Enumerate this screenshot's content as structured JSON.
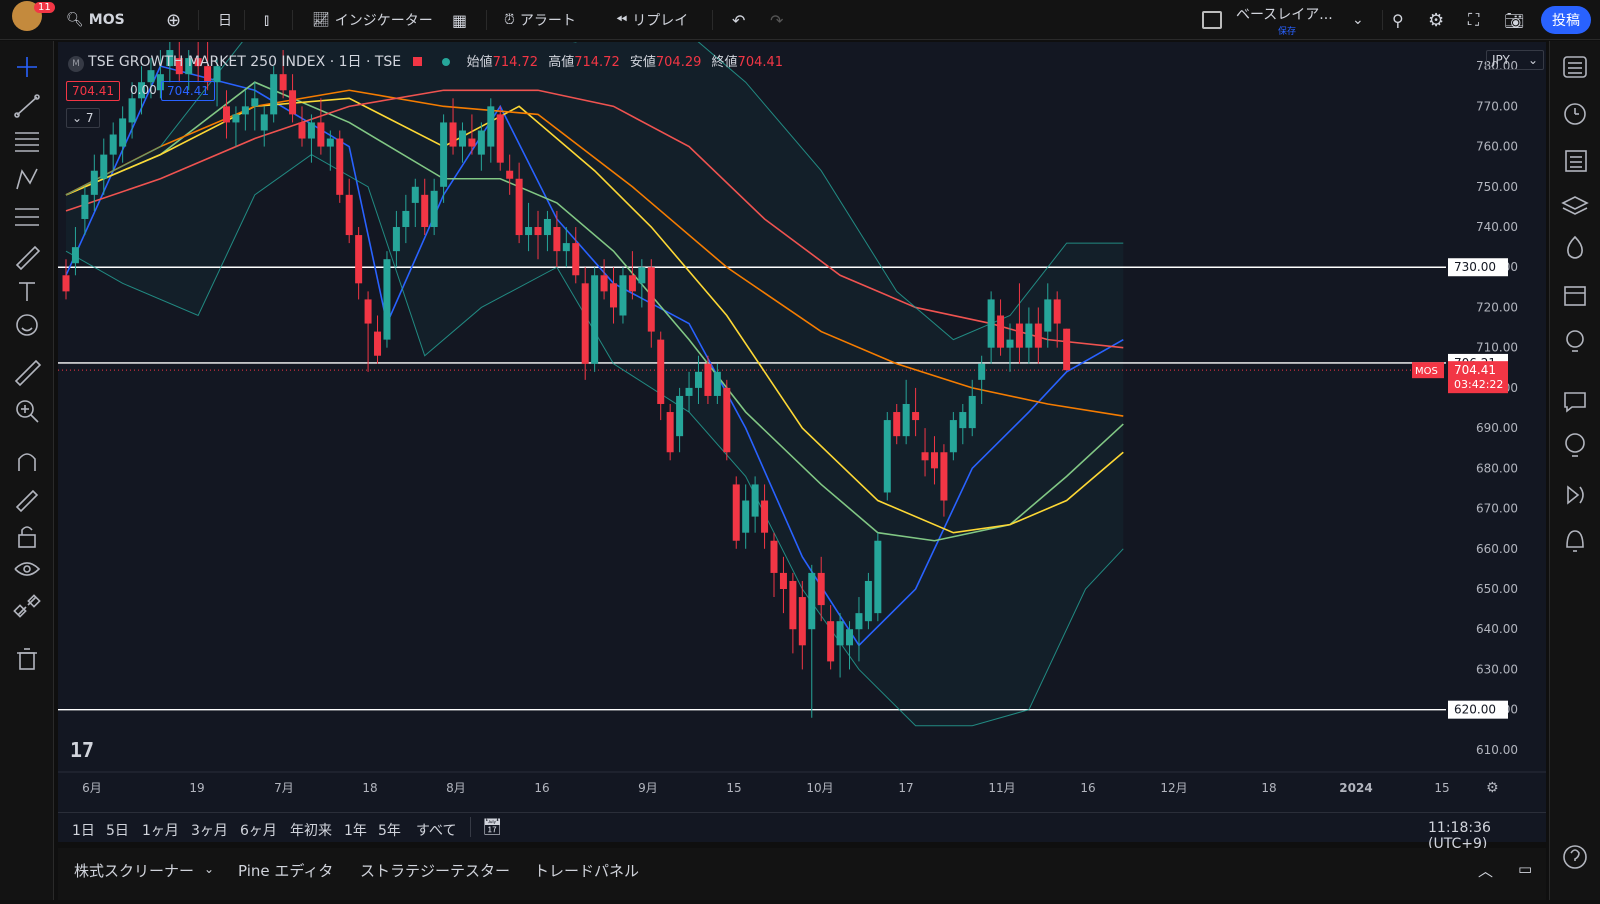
{
  "topbar": {
    "notif_count": "11",
    "symbol": "MOS",
    "interval": "日",
    "indicators": "インジケーター",
    "alert": "アラート",
    "replay": "リプレイ",
    "layout": "ベースレイア...",
    "layout_sub": "保存",
    "publish": "投稿"
  },
  "legend": {
    "title": "TSE GROWTH MARKET 250 INDEX · 1日 · TSE",
    "open_label": "始値",
    "open": "714.72",
    "high_label": "高値",
    "high": "714.72",
    "low_label": "安値",
    "low": "704.29",
    "close_label": "終値",
    "close": "704.41",
    "bid": "704.41",
    "spread": "0.00",
    "ask": "704.41",
    "indicators_count": "7"
  },
  "chart_data": {
    "type": "candlestick",
    "ylim": [
      605,
      786
    ],
    "y_ticks": [
      610,
      620,
      630,
      640,
      650,
      660,
      670,
      680,
      690,
      700,
      710,
      720,
      730,
      740,
      750,
      760,
      770,
      780
    ],
    "x_labels": [
      "6月",
      "19",
      "7月",
      "18",
      "8月",
      "16",
      "9月",
      "15",
      "10月",
      "17",
      "11月",
      "16",
      "12月",
      "18",
      "2024",
      "15"
    ],
    "currency": "JPY",
    "hlines": [
      730,
      706.21,
      620
    ],
    "hline_labels": [
      "730.00",
      "706.21",
      "620.00"
    ],
    "last_price": "704.41",
    "countdown": "03:42:22",
    "last_symbol": "MOS",
    "candles": [
      {
        "o": 728,
        "h": 732,
        "l": 722,
        "c": 724
      },
      {
        "o": 731,
        "h": 740,
        "l": 728,
        "c": 735
      },
      {
        "o": 742,
        "h": 750,
        "l": 738,
        "c": 748
      },
      {
        "o": 748,
        "h": 758,
        "l": 744,
        "c": 754
      },
      {
        "o": 752,
        "h": 762,
        "l": 748,
        "c": 758
      },
      {
        "o": 758,
        "h": 766,
        "l": 754,
        "c": 763
      },
      {
        "o": 760,
        "h": 770,
        "l": 756,
        "c": 767
      },
      {
        "o": 766,
        "h": 776,
        "l": 762,
        "c": 772
      },
      {
        "o": 772,
        "h": 780,
        "l": 768,
        "c": 776
      },
      {
        "o": 776,
        "h": 782,
        "l": 772,
        "c": 779
      },
      {
        "o": 774,
        "h": 784,
        "l": 772,
        "c": 778
      },
      {
        "o": 780,
        "h": 786,
        "l": 776,
        "c": 784
      },
      {
        "o": 782,
        "h": 786,
        "l": 776,
        "c": 778
      },
      {
        "o": 778,
        "h": 784,
        "l": 774,
        "c": 782
      },
      {
        "o": 782,
        "h": 786,
        "l": 776,
        "c": 780
      },
      {
        "o": 780,
        "h": 786,
        "l": 774,
        "c": 776
      },
      {
        "o": 776,
        "h": 782,
        "l": 770,
        "c": 780
      },
      {
        "o": 770,
        "h": 774,
        "l": 762,
        "c": 766
      },
      {
        "o": 766,
        "h": 770,
        "l": 760,
        "c": 768
      },
      {
        "o": 768,
        "h": 774,
        "l": 764,
        "c": 770
      },
      {
        "o": 770,
        "h": 776,
        "l": 764,
        "c": 772
      },
      {
        "o": 764,
        "h": 770,
        "l": 760,
        "c": 768
      },
      {
        "o": 768,
        "h": 780,
        "l": 766,
        "c": 778
      },
      {
        "o": 778,
        "h": 784,
        "l": 772,
        "c": 774
      },
      {
        "o": 774,
        "h": 778,
        "l": 766,
        "c": 768
      },
      {
        "o": 766,
        "h": 770,
        "l": 760,
        "c": 762
      },
      {
        "o": 762,
        "h": 768,
        "l": 756,
        "c": 766
      },
      {
        "o": 766,
        "h": 772,
        "l": 758,
        "c": 760
      },
      {
        "o": 760,
        "h": 764,
        "l": 754,
        "c": 762
      },
      {
        "o": 762,
        "h": 764,
        "l": 746,
        "c": 748
      },
      {
        "o": 748,
        "h": 752,
        "l": 736,
        "c": 738
      },
      {
        "o": 738,
        "h": 740,
        "l": 722,
        "c": 726
      },
      {
        "o": 722,
        "h": 724,
        "l": 704,
        "c": 716
      },
      {
        "o": 714,
        "h": 718,
        "l": 706,
        "c": 708
      },
      {
        "o": 712,
        "h": 734,
        "l": 710,
        "c": 732
      },
      {
        "o": 734,
        "h": 744,
        "l": 730,
        "c": 740
      },
      {
        "o": 740,
        "h": 748,
        "l": 736,
        "c": 744
      },
      {
        "o": 746,
        "h": 752,
        "l": 740,
        "c": 750
      },
      {
        "o": 748,
        "h": 752,
        "l": 738,
        "c": 740
      },
      {
        "o": 740,
        "h": 752,
        "l": 738,
        "c": 749
      },
      {
        "o": 750,
        "h": 768,
        "l": 746,
        "c": 766
      },
      {
        "o": 766,
        "h": 772,
        "l": 758,
        "c": 760
      },
      {
        "o": 760,
        "h": 766,
        "l": 756,
        "c": 764
      },
      {
        "o": 762,
        "h": 768,
        "l": 758,
        "c": 760
      },
      {
        "o": 758,
        "h": 766,
        "l": 754,
        "c": 764
      },
      {
        "o": 760,
        "h": 772,
        "l": 756,
        "c": 770
      },
      {
        "o": 768,
        "h": 770,
        "l": 754,
        "c": 756
      },
      {
        "o": 754,
        "h": 758,
        "l": 748,
        "c": 752
      },
      {
        "o": 752,
        "h": 756,
        "l": 736,
        "c": 738
      },
      {
        "o": 738,
        "h": 746,
        "l": 734,
        "c": 740
      },
      {
        "o": 740,
        "h": 744,
        "l": 732,
        "c": 738
      },
      {
        "o": 738,
        "h": 744,
        "l": 734,
        "c": 742
      },
      {
        "o": 740,
        "h": 744,
        "l": 730,
        "c": 734
      },
      {
        "o": 734,
        "h": 740,
        "l": 730,
        "c": 736
      },
      {
        "o": 736,
        "h": 740,
        "l": 726,
        "c": 728
      },
      {
        "o": 726,
        "h": 730,
        "l": 702,
        "c": 706
      },
      {
        "o": 706,
        "h": 730,
        "l": 704,
        "c": 728
      },
      {
        "o": 728,
        "h": 732,
        "l": 722,
        "c": 724
      },
      {
        "o": 726,
        "h": 730,
        "l": 716,
        "c": 720
      },
      {
        "o": 718,
        "h": 730,
        "l": 716,
        "c": 728
      },
      {
        "o": 728,
        "h": 734,
        "l": 722,
        "c": 724
      },
      {
        "o": 726,
        "h": 732,
        "l": 720,
        "c": 730
      },
      {
        "o": 730,
        "h": 732,
        "l": 710,
        "c": 714
      },
      {
        "o": 712,
        "h": 714,
        "l": 692,
        "c": 696
      },
      {
        "o": 694,
        "h": 696,
        "l": 682,
        "c": 684
      },
      {
        "o": 688,
        "h": 700,
        "l": 684,
        "c": 698
      },
      {
        "o": 698,
        "h": 704,
        "l": 694,
        "c": 700
      },
      {
        "o": 700,
        "h": 708,
        "l": 696,
        "c": 704
      },
      {
        "o": 706,
        "h": 708,
        "l": 696,
        "c": 698
      },
      {
        "o": 698,
        "h": 706,
        "l": 696,
        "c": 704
      },
      {
        "o": 700,
        "h": 702,
        "l": 682,
        "c": 684
      },
      {
        "o": 676,
        "h": 678,
        "l": 660,
        "c": 662
      },
      {
        "o": 664,
        "h": 676,
        "l": 660,
        "c": 672
      },
      {
        "o": 668,
        "h": 678,
        "l": 664,
        "c": 676
      },
      {
        "o": 672,
        "h": 676,
        "l": 660,
        "c": 664
      },
      {
        "o": 662,
        "h": 664,
        "l": 648,
        "c": 654
      },
      {
        "o": 654,
        "h": 658,
        "l": 644,
        "c": 650
      },
      {
        "o": 652,
        "h": 654,
        "l": 634,
        "c": 640
      },
      {
        "o": 648,
        "h": 652,
        "l": 630,
        "c": 636
      },
      {
        "o": 640,
        "h": 656,
        "l": 618,
        "c": 654
      },
      {
        "o": 654,
        "h": 658,
        "l": 642,
        "c": 646
      },
      {
        "o": 642,
        "h": 646,
        "l": 630,
        "c": 632
      },
      {
        "o": 636,
        "h": 644,
        "l": 628,
        "c": 642
      },
      {
        "o": 636,
        "h": 642,
        "l": 630,
        "c": 640
      },
      {
        "o": 640,
        "h": 648,
        "l": 632,
        "c": 644
      },
      {
        "o": 642,
        "h": 654,
        "l": 640,
        "c": 652
      },
      {
        "o": 644,
        "h": 664,
        "l": 642,
        "c": 662
      },
      {
        "o": 674,
        "h": 694,
        "l": 672,
        "c": 692
      },
      {
        "o": 694,
        "h": 696,
        "l": 686,
        "c": 688
      },
      {
        "o": 688,
        "h": 702,
        "l": 686,
        "c": 696
      },
      {
        "o": 694,
        "h": 700,
        "l": 688,
        "c": 692
      },
      {
        "o": 684,
        "h": 690,
        "l": 678,
        "c": 682
      },
      {
        "o": 684,
        "h": 688,
        "l": 676,
        "c": 680
      },
      {
        "o": 684,
        "h": 686,
        "l": 668,
        "c": 672
      },
      {
        "o": 684,
        "h": 694,
        "l": 682,
        "c": 692
      },
      {
        "o": 690,
        "h": 696,
        "l": 686,
        "c": 694
      },
      {
        "o": 690,
        "h": 702,
        "l": 688,
        "c": 698
      },
      {
        "o": 702,
        "h": 708,
        "l": 696,
        "c": 706
      },
      {
        "o": 710,
        "h": 724,
        "l": 706,
        "c": 722
      },
      {
        "o": 718,
        "h": 722,
        "l": 708,
        "c": 710
      },
      {
        "o": 710,
        "h": 716,
        "l": 704,
        "c": 712
      },
      {
        "o": 716,
        "h": 726,
        "l": 706,
        "c": 710
      },
      {
        "o": 710,
        "h": 720,
        "l": 706,
        "c": 716
      },
      {
        "o": 716,
        "h": 720,
        "l": 706,
        "c": 710
      },
      {
        "o": 714,
        "h": 726,
        "l": 710,
        "c": 722
      },
      {
        "o": 722,
        "h": 724,
        "l": 710,
        "c": 716
      },
      {
        "o": 714.72,
        "h": 714.72,
        "l": 704.29,
        "c": 704.41
      }
    ],
    "ma_series": [
      {
        "name": "ma-fast",
        "color": "#2962ff",
        "points": [
          [
            0,
            728
          ],
          [
            10,
            780
          ],
          [
            20,
            774
          ],
          [
            30,
            760
          ],
          [
            34,
            716
          ],
          [
            40,
            748
          ],
          [
            46,
            770
          ],
          [
            52,
            742
          ],
          [
            58,
            726
          ],
          [
            66,
            716
          ],
          [
            72,
            690
          ],
          [
            78,
            658
          ],
          [
            84,
            636
          ],
          [
            90,
            650
          ],
          [
            96,
            680
          ],
          [
            102,
            694
          ],
          [
            106,
            704
          ],
          [
            112,
            712
          ]
        ]
      },
      {
        "name": "ma-mid",
        "color": "#81c784",
        "points": [
          [
            0,
            748
          ],
          [
            10,
            758
          ],
          [
            20,
            776
          ],
          [
            30,
            766
          ],
          [
            40,
            752
          ],
          [
            46,
            752
          ],
          [
            52,
            746
          ],
          [
            58,
            734
          ],
          [
            66,
            712
          ],
          [
            72,
            694
          ],
          [
            80,
            676
          ],
          [
            86,
            664
          ],
          [
            92,
            662
          ],
          [
            100,
            666
          ],
          [
            106,
            678
          ],
          [
            112,
            691
          ]
        ]
      },
      {
        "name": "ma-slow",
        "color": "#fdd835",
        "points": [
          [
            0,
            748
          ],
          [
            10,
            758
          ],
          [
            20,
            770
          ],
          [
            30,
            772
          ],
          [
            40,
            760
          ],
          [
            48,
            770
          ],
          [
            56,
            754
          ],
          [
            62,
            740
          ],
          [
            70,
            718
          ],
          [
            78,
            690
          ],
          [
            86,
            672
          ],
          [
            94,
            664
          ],
          [
            100,
            666
          ],
          [
            106,
            672
          ],
          [
            112,
            684
          ]
        ]
      },
      {
        "name": "ma-long",
        "color": "#f57c00",
        "points": [
          [
            0,
            748
          ],
          [
            10,
            760
          ],
          [
            20,
            770
          ],
          [
            30,
            774
          ],
          [
            40,
            770
          ],
          [
            50,
            768
          ],
          [
            60,
            750
          ],
          [
            70,
            730
          ],
          [
            80,
            714
          ],
          [
            88,
            706
          ],
          [
            96,
            700
          ],
          [
            104,
            696
          ],
          [
            112,
            693
          ]
        ]
      },
      {
        "name": "ma-200",
        "color": "#ef5350",
        "points": [
          [
            0,
            744
          ],
          [
            10,
            752
          ],
          [
            20,
            762
          ],
          [
            30,
            770
          ],
          [
            40,
            774
          ],
          [
            50,
            774
          ],
          [
            58,
            770
          ],
          [
            66,
            760
          ],
          [
            74,
            742
          ],
          [
            82,
            728
          ],
          [
            90,
            720
          ],
          [
            98,
            716
          ],
          [
            104,
            712
          ],
          [
            112,
            710
          ]
        ]
      },
      {
        "name": "bb-upper",
        "color": "#26a69a",
        "points": [
          [
            0,
            748
          ],
          [
            10,
            760
          ],
          [
            20,
            790
          ],
          [
            30,
            792
          ],
          [
            36,
            792
          ],
          [
            44,
            790
          ],
          [
            54,
            786
          ],
          [
            60,
            792
          ],
          [
            66,
            788
          ],
          [
            72,
            776
          ],
          [
            80,
            754
          ],
          [
            88,
            724
          ],
          [
            94,
            712
          ],
          [
            100,
            718
          ],
          [
            106,
            736
          ],
          [
            112,
            736
          ]
        ]
      },
      {
        "name": "bb-lower",
        "color": "#26a69a",
        "points": [
          [
            0,
            734
          ],
          [
            6,
            726
          ],
          [
            14,
            718
          ],
          [
            20,
            748
          ],
          [
            26,
            758
          ],
          [
            32,
            750
          ],
          [
            38,
            708
          ],
          [
            44,
            720
          ],
          [
            52,
            730
          ],
          [
            58,
            706
          ],
          [
            66,
            694
          ],
          [
            72,
            678
          ],
          [
            78,
            650
          ],
          [
            84,
            630
          ],
          [
            90,
            616
          ],
          [
            96,
            616
          ],
          [
            102,
            620
          ],
          [
            108,
            650
          ],
          [
            112,
            660
          ]
        ]
      }
    ]
  },
  "range_buttons": [
    "1日",
    "5日",
    "1ヶ月",
    "3ヶ月",
    "6ヶ月",
    "年初来",
    "1年",
    "5年",
    "すべて"
  ],
  "clock": "11:18:36 (UTC+9)",
  "bottom_tabs": [
    "株式スクリーナー",
    "Pine エディタ",
    "ストラテジーテスター",
    "トレードパネル"
  ],
  "colors": {
    "up": "#26a69a",
    "down": "#f23645",
    "bg": "#131722",
    "accent": "#2962ff"
  }
}
